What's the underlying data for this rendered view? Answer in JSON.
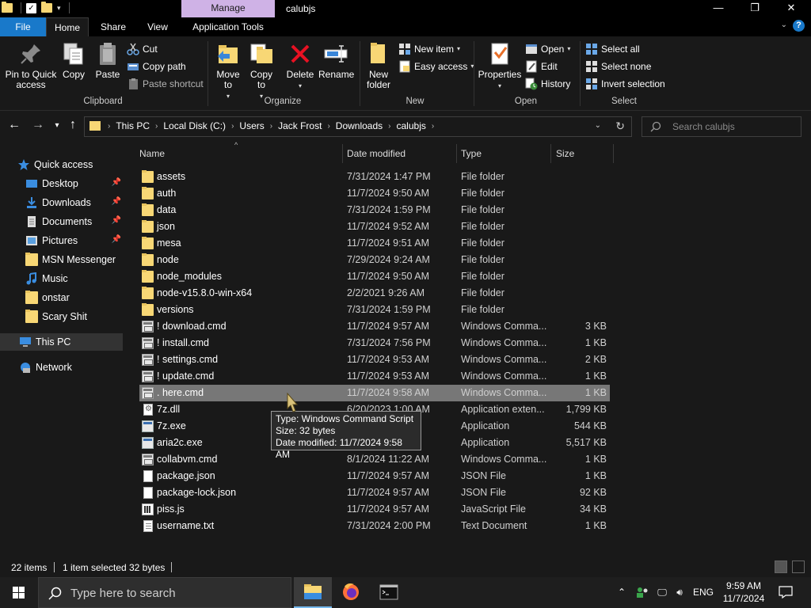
{
  "window": {
    "title": "calubjs",
    "context_tab": "Manage",
    "minimize": "—",
    "maximize": "❐",
    "close": "✕"
  },
  "ribbon_tabs": {
    "file": "File",
    "home": "Home",
    "share": "Share",
    "view": "View",
    "app_tools": "Application Tools"
  },
  "ribbon": {
    "clipboard": {
      "label": "Clipboard",
      "pin": "Pin to Quick access",
      "copy": "Copy",
      "paste": "Paste",
      "cut": "Cut",
      "copy_path": "Copy path",
      "paste_shortcut": "Paste shortcut"
    },
    "organize": {
      "label": "Organize",
      "move_to": "Move to",
      "copy_to": "Copy to",
      "delete": "Delete",
      "rename": "Rename"
    },
    "new": {
      "label": "New",
      "new_folder": "New folder",
      "new_item": "New item",
      "easy_access": "Easy access"
    },
    "open": {
      "label": "Open",
      "properties": "Properties",
      "open": "Open",
      "edit": "Edit",
      "history": "History"
    },
    "select": {
      "label": "Select",
      "select_all": "Select all",
      "select_none": "Select none",
      "invert": "Invert selection"
    }
  },
  "address": {
    "crumbs": [
      "This PC",
      "Local Disk (C:)",
      "Users",
      "Jack Frost",
      "Downloads",
      "calubjs"
    ]
  },
  "search": {
    "placeholder": "Search calubjs"
  },
  "nav_pane": {
    "quick_access": "Quick access",
    "items": [
      {
        "label": "Desktop",
        "pinned": true
      },
      {
        "label": "Downloads",
        "pinned": true
      },
      {
        "label": "Documents",
        "pinned": true
      },
      {
        "label": "Pictures",
        "pinned": true
      },
      {
        "label": "MSN Messenger",
        "pinned": false
      },
      {
        "label": "Music",
        "pinned": false
      },
      {
        "label": "onstar",
        "pinned": false
      },
      {
        "label": "Scary Shit",
        "pinned": false
      }
    ],
    "this_pc": "This PC",
    "network": "Network"
  },
  "columns": {
    "name": "Name",
    "date": "Date modified",
    "type": "Type",
    "size": "Size"
  },
  "files": [
    {
      "name": "assets",
      "date": "7/31/2024 1:47 PM",
      "type": "File folder",
      "size": "",
      "icon": "folder"
    },
    {
      "name": "auth",
      "date": "11/7/2024 9:50 AM",
      "type": "File folder",
      "size": "",
      "icon": "folder"
    },
    {
      "name": "data",
      "date": "7/31/2024 1:59 PM",
      "type": "File folder",
      "size": "",
      "icon": "folder"
    },
    {
      "name": "json",
      "date": "11/7/2024 9:52 AM",
      "type": "File folder",
      "size": "",
      "icon": "folder"
    },
    {
      "name": "mesa",
      "date": "11/7/2024 9:51 AM",
      "type": "File folder",
      "size": "",
      "icon": "folder"
    },
    {
      "name": "node",
      "date": "7/29/2024 9:24 AM",
      "type": "File folder",
      "size": "",
      "icon": "folder"
    },
    {
      "name": "node_modules",
      "date": "11/7/2024 9:50 AM",
      "type": "File folder",
      "size": "",
      "icon": "folder"
    },
    {
      "name": "node-v15.8.0-win-x64",
      "date": "2/2/2021 9:26 AM",
      "type": "File folder",
      "size": "",
      "icon": "folder"
    },
    {
      "name": "versions",
      "date": "7/31/2024 1:59 PM",
      "type": "File folder",
      "size": "",
      "icon": "folder"
    },
    {
      "name": "! download.cmd",
      "date": "11/7/2024 9:57 AM",
      "type": "Windows Comma...",
      "size": "3 KB",
      "icon": "cmd"
    },
    {
      "name": "! install.cmd",
      "date": "7/31/2024 7:56 PM",
      "type": "Windows Comma...",
      "size": "1 KB",
      "icon": "cmd"
    },
    {
      "name": "! settings.cmd",
      "date": "11/7/2024 9:53 AM",
      "type": "Windows Comma...",
      "size": "2 KB",
      "icon": "cmd"
    },
    {
      "name": "! update.cmd",
      "date": "11/7/2024 9:53 AM",
      "type": "Windows Comma...",
      "size": "1 KB",
      "icon": "cmd"
    },
    {
      "name": ". here.cmd",
      "date": "11/7/2024 9:58 AM",
      "type": "Windows Comma...",
      "size": "1 KB",
      "icon": "cmd",
      "selected": true
    },
    {
      "name": "7z.dll",
      "date": "6/20/2023 1:00 AM",
      "type": "Application exten...",
      "size": "1,799 KB",
      "icon": "dll"
    },
    {
      "name": "7z.exe",
      "date": "",
      "type": "Application",
      "size": "544 KB",
      "icon": "exe"
    },
    {
      "name": "aria2c.exe",
      "date": "",
      "type": "Application",
      "size": "5,517 KB",
      "icon": "exe"
    },
    {
      "name": "collabvm.cmd",
      "date": "8/1/2024 11:22 AM",
      "type": "Windows Comma...",
      "size": "1 KB",
      "icon": "cmd"
    },
    {
      "name": "package.json",
      "date": "11/7/2024 9:57 AM",
      "type": "JSON File",
      "size": "1 KB",
      "icon": "doc"
    },
    {
      "name": "package-lock.json",
      "date": "11/7/2024 9:57 AM",
      "type": "JSON File",
      "size": "92 KB",
      "icon": "doc"
    },
    {
      "name": "piss.js",
      "date": "11/7/2024 9:57 AM",
      "type": "JavaScript File",
      "size": "34 KB",
      "icon": "js"
    },
    {
      "name": "username.txt",
      "date": "7/31/2024 2:00 PM",
      "type": "Text Document",
      "size": "1 KB",
      "icon": "txt"
    }
  ],
  "tooltip": {
    "line1": "Type: Windows Command Script",
    "line2": "Size: 32 bytes",
    "line3": "Date modified: 11/7/2024 9:58 AM"
  },
  "status": {
    "items": "22 items",
    "selected": "1 item selected",
    "size": "32 bytes"
  },
  "taskbar": {
    "search_placeholder": "Type here to search",
    "lang": "ENG",
    "time": "9:59 AM",
    "date": "11/7/2024"
  },
  "colors": {
    "accent": "#1979ca",
    "folder": "#f8d775",
    "selection": "#777777",
    "background": "#191919"
  }
}
